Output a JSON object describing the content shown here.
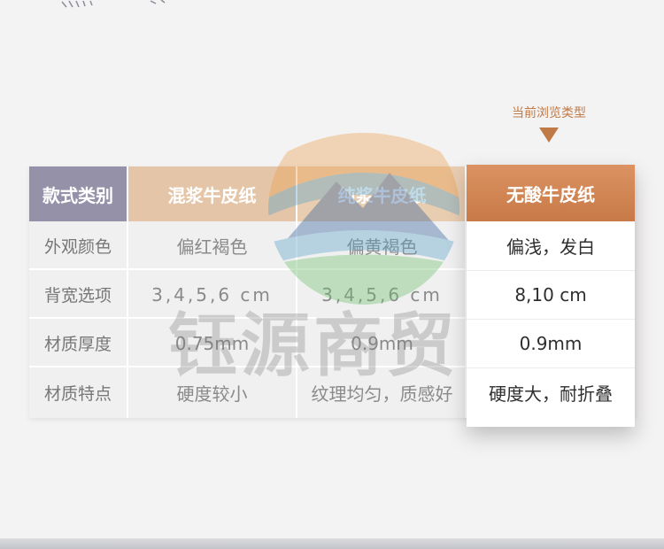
{
  "hint": {
    "label": "当前浏览类型"
  },
  "watermark": {
    "text": "钰源商贸"
  },
  "table": {
    "headers": [
      "款式类别",
      "混浆牛皮纸",
      "纯浆牛皮纸",
      "无酸牛皮纸"
    ],
    "rows": [
      {
        "label": "外观颜色",
        "values": [
          "偏红褐色",
          "偏黄褐色",
          "偏浅，发白"
        ]
      },
      {
        "label": "背宽选项",
        "values": [
          "3,4,5,6 cm",
          "3,4,5,6 cm",
          "8,10 cm"
        ]
      },
      {
        "label": "材质厚度",
        "values": [
          "0.75mm",
          "0.9mm",
          "0.9mm"
        ]
      },
      {
        "label": "材质特点",
        "values": [
          "硬度较小",
          "纹理均匀，质感好",
          "硬度大，耐折叠"
        ]
      }
    ]
  },
  "colors": {
    "label_header": "#9591a9",
    "col1_header": "#e5c5a7",
    "col2_header": "#e9cdb1",
    "selected_header": "#cf8553",
    "hint": "#c07a45"
  }
}
